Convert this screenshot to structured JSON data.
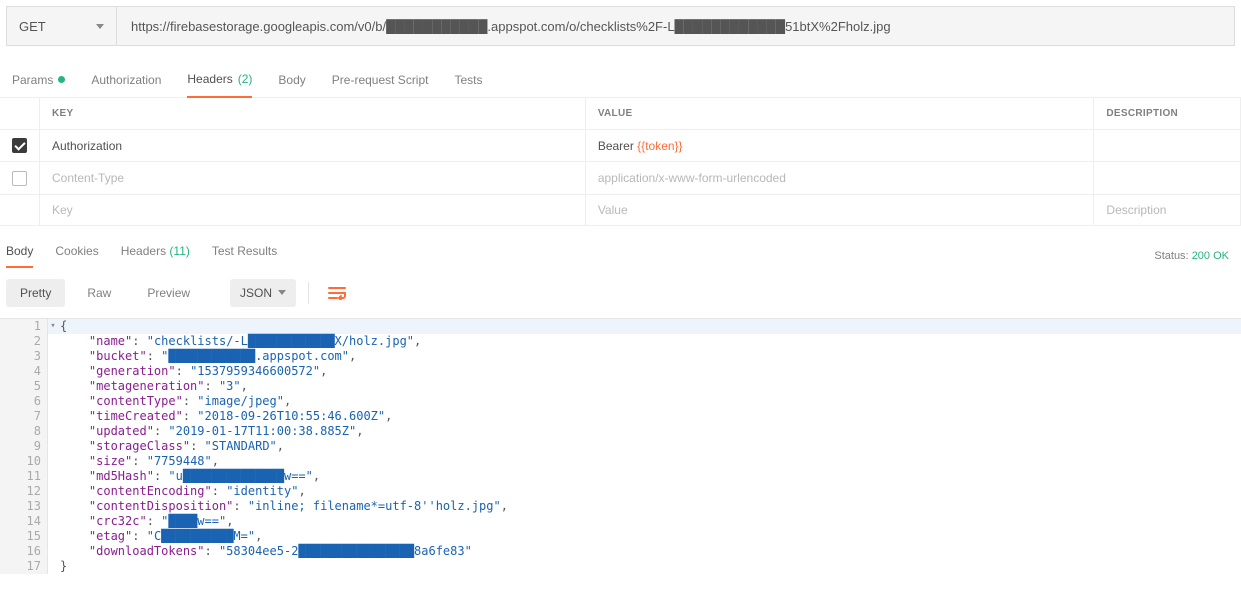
{
  "request": {
    "method": "GET",
    "url": "https://firebasestorage.googleapis.com/v0/b/███████████.appspot.com/o/checklists%2F-L████████████51btX%2Fholz.jpg"
  },
  "reqTabs": {
    "params": "Params",
    "authorization": "Authorization",
    "headers": "Headers",
    "headersCount": "(2)",
    "body": "Body",
    "prerequest": "Pre-request Script",
    "tests": "Tests"
  },
  "headersTable": {
    "col_key": "KEY",
    "col_value": "VALUE",
    "col_desc": "DESCRIPTION",
    "rows": [
      {
        "enabled": true,
        "key": "Authorization",
        "value_prefix": "Bearer ",
        "value_var": "{{token}}",
        "disabled": false
      },
      {
        "enabled": false,
        "key": "Content-Type",
        "value_prefix": "application/x-www-form-urlencoded",
        "value_var": "",
        "disabled": true
      }
    ],
    "ph_key": "Key",
    "ph_value": "Value",
    "ph_desc": "Description"
  },
  "respTabs": {
    "body": "Body",
    "cookies": "Cookies",
    "headers": "Headers",
    "headersCount": "(11)",
    "testresults": "Test Results"
  },
  "status": {
    "label": "Status:",
    "code": "200 OK"
  },
  "viewer": {
    "pretty": "Pretty",
    "raw": "Raw",
    "preview": "Preview",
    "format": "JSON"
  },
  "json": {
    "name": {
      "k": "\"name\"",
      "v": "\"checklists/-L████████████X/holz.jpg\""
    },
    "bucket": {
      "k": "\"bucket\"",
      "v": "\"████████████.appspot.com\""
    },
    "generation": {
      "k": "\"generation\"",
      "v": "\"1537959346600572\""
    },
    "metageneration": {
      "k": "\"metageneration\"",
      "v": "\"3\""
    },
    "contentType": {
      "k": "\"contentType\"",
      "v": "\"image/jpeg\""
    },
    "timeCreated": {
      "k": "\"timeCreated\"",
      "v": "\"2018-09-26T10:55:46.600Z\""
    },
    "updated": {
      "k": "\"updated\"",
      "v": "\"2019-01-17T11:00:38.885Z\""
    },
    "storageClass": {
      "k": "\"storageClass\"",
      "v": "\"STANDARD\""
    },
    "size": {
      "k": "\"size\"",
      "v": "\"7759448\""
    },
    "md5Hash": {
      "k": "\"md5Hash\"",
      "v": "\"u██████████████w==\""
    },
    "contentEncoding": {
      "k": "\"contentEncoding\"",
      "v": "\"identity\""
    },
    "contentDisposition": {
      "k": "\"contentDisposition\"",
      "v": "\"inline; filename*=utf-8''holz.jpg\""
    },
    "crc32c": {
      "k": "\"crc32c\"",
      "v": "\"████w==\""
    },
    "etag": {
      "k": "\"etag\"",
      "v": "\"C██████████M=\""
    },
    "downloadTokens": {
      "k": "\"downloadTokens\"",
      "v": "\"58304ee5-2████████████████8a6fe83\""
    }
  }
}
